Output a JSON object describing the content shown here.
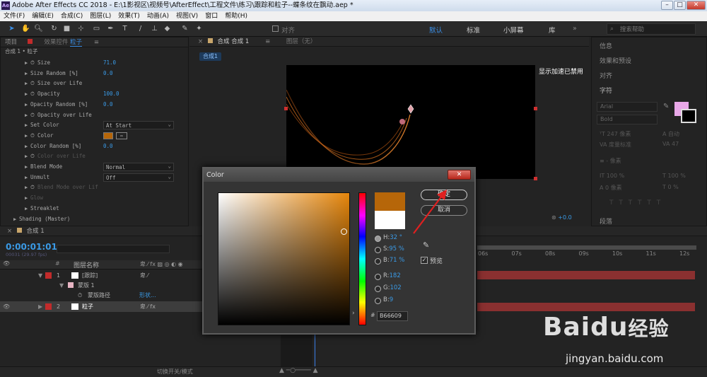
{
  "window": {
    "app_icon": "Ae",
    "title": "Adobe After Effects CC 2018 - E:\\1影视区\\视频号\\AfterEffect\\工程文件\\练习\\跟踪和粒子--蝶条纹在飘动.aep *"
  },
  "menu": [
    "文件(F)",
    "编辑(E)",
    "合成(C)",
    "图层(L)",
    "效果(T)",
    "动画(A)",
    "视图(V)",
    "窗口",
    "帮助(H)"
  ],
  "toolbar": {
    "snap_label": "对齐",
    "workspaces": [
      "默认",
      "标准",
      "小屏幕",
      "库"
    ],
    "search_placeholder": "搜索帮助"
  },
  "left_panel": {
    "tabs": [
      "项目",
      "效果控件",
      "粒子"
    ],
    "breadcrumb": "合成 1 • 粒子",
    "rows": [
      {
        "label": "Size",
        "value": "71.0",
        "indent": 1,
        "stopwatch": true
      },
      {
        "label": "Size Random [%]",
        "value": "0.0",
        "indent": 1,
        "stopwatch": false
      },
      {
        "label": "Size over Life",
        "value": "",
        "indent": 1,
        "stopwatch": true
      },
      {
        "label": "Opacity",
        "value": "100.0",
        "indent": 1,
        "stopwatch": true
      },
      {
        "label": "Opacity Random [%]",
        "value": "0.0",
        "indent": 1,
        "stopwatch": false
      },
      {
        "label": "Opacity over Life",
        "value": "",
        "indent": 1,
        "stopwatch": true
      },
      {
        "label": "Set Color",
        "value": "",
        "dropdown": "At Start",
        "indent": 1,
        "stopwatch": false
      },
      {
        "label": "Color",
        "value": "",
        "indent": 1,
        "stopwatch": true,
        "color": "#B66609"
      },
      {
        "label": "Color Random [%]",
        "value": "0.0",
        "indent": 1,
        "stopwatch": false
      },
      {
        "label": "Color over Life",
        "value": "",
        "indent": 1,
        "stopwatch": true,
        "dim": true
      },
      {
        "label": "Blend Mode",
        "value": "",
        "dropdown": "Normal",
        "indent": 1,
        "stopwatch": false
      },
      {
        "label": "Unmult",
        "value": "",
        "dropdown": "Off",
        "indent": 1,
        "stopwatch": false
      },
      {
        "label": "Blend Mode over Lif",
        "value": "",
        "indent": 1,
        "stopwatch": true,
        "dim": true
      },
      {
        "label": "Glow",
        "value": "",
        "indent": 1,
        "stopwatch": false,
        "dim": true
      },
      {
        "label": "Streaklet",
        "value": "",
        "indent": 1,
        "stopwatch": false
      },
      {
        "label": "Shading (Master)",
        "value": "",
        "indent": 0,
        "stopwatch": false
      }
    ]
  },
  "viewer": {
    "tab_comp": "合成 1",
    "tab_layer": "图层（无）",
    "comp_pill": "合成1",
    "accel_notice": "显示加速已禁用",
    "zoom": "+0.0"
  },
  "right_panel": {
    "items": [
      "信息",
      "效果和预设",
      "对齐",
      "字符"
    ],
    "font": "Arial",
    "style": "Bold",
    "size_text": "247 像素",
    "auto_text": "自动",
    "kern_text": "度量标准",
    "track_text": "47",
    "unit_text": "- 像素",
    "pct1": "100 %",
    "pct2": "100 %",
    "px1": "0 像素",
    "pct3": "0 %",
    "bottom": "段落",
    "swatch_color": "#e9a8e8"
  },
  "timeline": {
    "tab": "合成 1",
    "timecode": "0:00:01:01",
    "fps_note": "00031 (29.97 fps)",
    "col_header": "图层名称",
    "layers": [
      {
        "num": "1",
        "name": "[跟踪]",
        "color": "#c22b2b"
      },
      {
        "num": "",
        "name": "蒙版 1",
        "color": "#e7b5c3"
      },
      {
        "num": "",
        "name": "蒙版路径",
        "color": ""
      },
      {
        "num": "2",
        "name": "粒子",
        "color": "#c22b2b"
      }
    ],
    "mask_path_value": "形状...",
    "ruler": [
      "06s",
      "07s",
      "08s",
      "09s",
      "10s",
      "11s",
      "12s"
    ],
    "bottom_label": "切换开关/模式"
  },
  "color_dialog": {
    "title": "Color",
    "ok_label": "确定",
    "cancel_label": "取消",
    "new_color": "#B66609",
    "old_color": "#FFFFFF",
    "hsb": [
      {
        "label": "H:",
        "value": "32 °"
      },
      {
        "label": "S:",
        "value": "95 %"
      },
      {
        "label": "B:",
        "value": "71 %"
      }
    ],
    "rgb": [
      {
        "label": "R:",
        "value": "182"
      },
      {
        "label": "G:",
        "value": "102"
      },
      {
        "label": "B:",
        "value": "9"
      }
    ],
    "preview_label": "预览",
    "hex_hash": "#",
    "hex": "B66609",
    "selected_mode": "H"
  },
  "watermark": {
    "brand": "Baidu",
    "brand_cn": "经验",
    "url": "jingyan.baidu.com"
  }
}
